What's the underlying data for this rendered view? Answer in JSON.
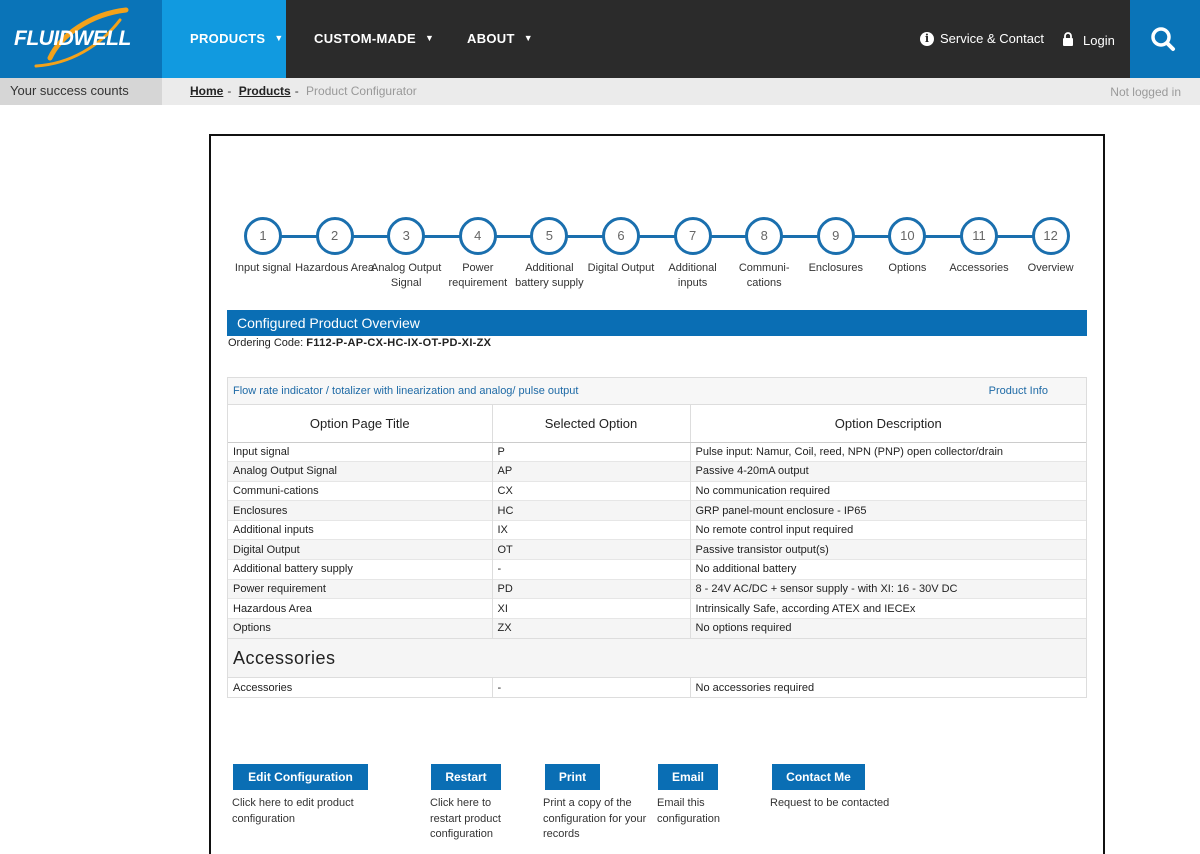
{
  "brand": {
    "logo_text": "FLUIDWELL",
    "tagline": "Your success counts",
    "colors": {
      "brand_blue": "#0a74b8",
      "nav_active": "#119ae0",
      "nav_bg": "#2b2b2b"
    }
  },
  "nav": {
    "products": "PRODUCTS",
    "custom": "CUSTOM-MADE",
    "about": "ABOUT",
    "caret": "▼",
    "service": "Service & Contact",
    "login": "Login",
    "info_glyph": "i"
  },
  "breadcrumb": {
    "home": "Home",
    "products": "Products",
    "current": "Product Configurator",
    "sep": "-"
  },
  "status": {
    "not_logged": "Not logged in"
  },
  "steps": [
    {
      "num": "1",
      "label": "Input signal"
    },
    {
      "num": "2",
      "label": "Hazardous Area"
    },
    {
      "num": "3",
      "label": "Analog Output Signal"
    },
    {
      "num": "4",
      "label": "Power requirement"
    },
    {
      "num": "5",
      "label": "Additional battery supply"
    },
    {
      "num": "6",
      "label": "Digital Output"
    },
    {
      "num": "7",
      "label": "Additional inputs"
    },
    {
      "num": "8",
      "label": "Communi-cations"
    },
    {
      "num": "9",
      "label": "Enclosures"
    },
    {
      "num": "10",
      "label": "Options"
    },
    {
      "num": "11",
      "label": "Accessories"
    },
    {
      "num": "12",
      "label": "Overview"
    }
  ],
  "overview": {
    "title": "Configured Product Overview",
    "ordering_label": "Ordering Code:",
    "ordering_code": "F112-P-AP-CX-HC-IX-OT-PD-XI-ZX",
    "product_name": "Flow rate indicator / totalizer with linearization and analog/ pulse output",
    "product_info": "Product Info",
    "headers": [
      "Option Page Title",
      "Selected Option",
      "Option Description"
    ],
    "rows": [
      [
        "Input signal",
        "P",
        "Pulse input: Namur, Coil, reed, NPN (PNP) open collector/drain"
      ],
      [
        "Analog Output Signal",
        "AP",
        "Passive 4-20mA output"
      ],
      [
        "Communi-cations",
        "CX",
        "No communication required"
      ],
      [
        "Enclosures",
        "HC",
        "GRP panel-mount enclosure - IP65"
      ],
      [
        "Additional inputs",
        "IX",
        "No remote control input required"
      ],
      [
        "Digital Output",
        "OT",
        "Passive transistor output(s)"
      ],
      [
        "Additional battery supply",
        "-",
        "No additional battery"
      ],
      [
        "Power requirement",
        "PD",
        "8 - 24V AC/DC + sensor supply - with XI: 16 - 30V DC"
      ],
      [
        "Hazardous Area",
        "XI",
        "Intrinsically Safe, according ATEX and IECEx"
      ],
      [
        "Options",
        "ZX",
        "No options required"
      ]
    ],
    "accessories_heading": "Accessories",
    "accessories_row": [
      "Accessories",
      "-",
      "No accessories required"
    ]
  },
  "actions": [
    {
      "label": "Edit Configuration",
      "desc": "Click here to edit product configuration"
    },
    {
      "label": "Restart",
      "desc": "Click here to restart product configuration"
    },
    {
      "label": "Print",
      "desc": "Print a copy of the configuration for your records"
    },
    {
      "label": "Email",
      "desc": "Email this configuration"
    },
    {
      "label": "Contact Me",
      "desc": "Request to be contacted"
    }
  ]
}
